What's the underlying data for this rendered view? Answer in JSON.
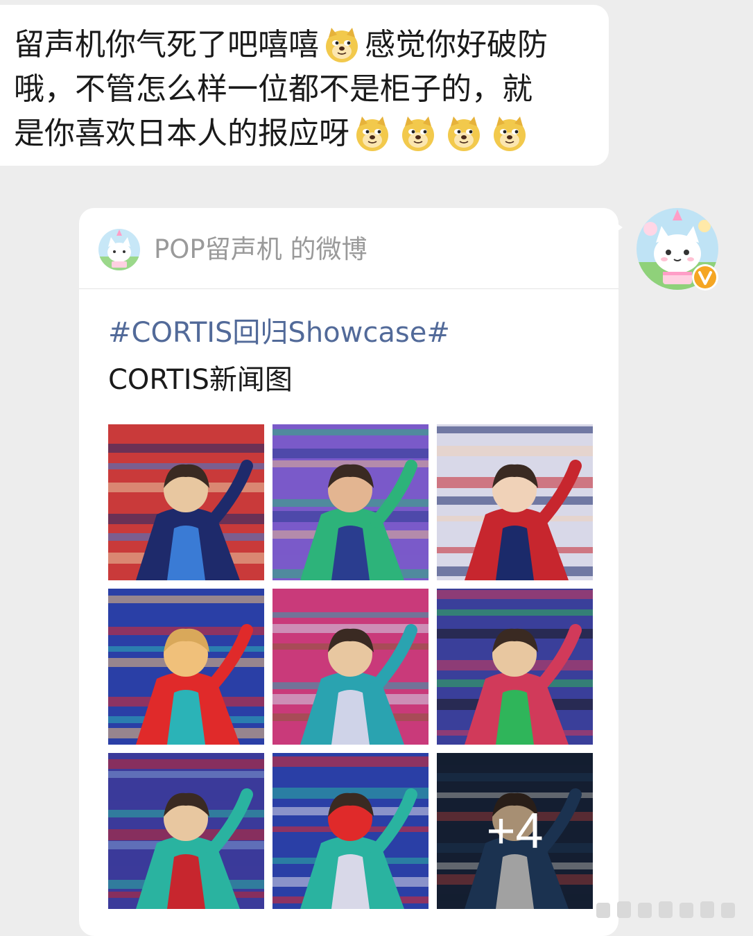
{
  "message": {
    "lines": [
      {
        "before": "留声机你气死了吧嘻嘻",
        "after": "感觉你好破防"
      },
      {
        "text": "哦，不管怎么样一位都不是柜子的，就"
      },
      {
        "text": "是你喜欢日本人的报应呀"
      }
    ],
    "emoji_icon": "doge-emoji-icon"
  },
  "card": {
    "source": "POP留声机 的微博",
    "hashtag": "#CORTIS回归Showcase#",
    "text": "CORTIS新闻图",
    "more_count": "+4",
    "photos": [
      {
        "name": "photo-1",
        "palette": [
          "#c93a3a",
          "#1e2a6b",
          "#3a7bd5",
          "#e8c7a0"
        ]
      },
      {
        "name": "photo-2",
        "palette": [
          "#7a5ac9",
          "#2db37a",
          "#2a3d8f",
          "#e3b591"
        ]
      },
      {
        "name": "photo-3",
        "palette": [
          "#d8d8e8",
          "#c7262e",
          "#1b2a6a",
          "#f0d2b8"
        ]
      },
      {
        "name": "photo-4",
        "palette": [
          "#2a3fa6",
          "#e02a2a",
          "#2bb3b7",
          "#f0c07a"
        ]
      },
      {
        "name": "photo-5",
        "palette": [
          "#c93a7a",
          "#2aa3b0",
          "#cfd3e8",
          "#8c5a3a"
        ]
      },
      {
        "name": "photo-6",
        "palette": [
          "#3a3f9a",
          "#d13a5a",
          "#2fb55a",
          "#1a1a1a"
        ]
      },
      {
        "name": "photo-7",
        "palette": [
          "#3b3a9a",
          "#2ab3a0",
          "#c7262e",
          "#7d9ad1"
        ]
      },
      {
        "name": "photo-8",
        "palette": [
          "#2a3fa6",
          "#2ab3a0",
          "#d8d8e8",
          "#e02a2a"
        ]
      },
      {
        "name": "photo-9",
        "palette": [
          "#1c2a44",
          "#26466f",
          "#e0e0e0",
          "#c94a4a"
        ]
      }
    ]
  },
  "colors": {
    "background": "#ededed",
    "bubble": "#ffffff",
    "hashtag": "#526a99",
    "source_text": "#9a9a9a",
    "verified_badge": "#f5a623"
  }
}
